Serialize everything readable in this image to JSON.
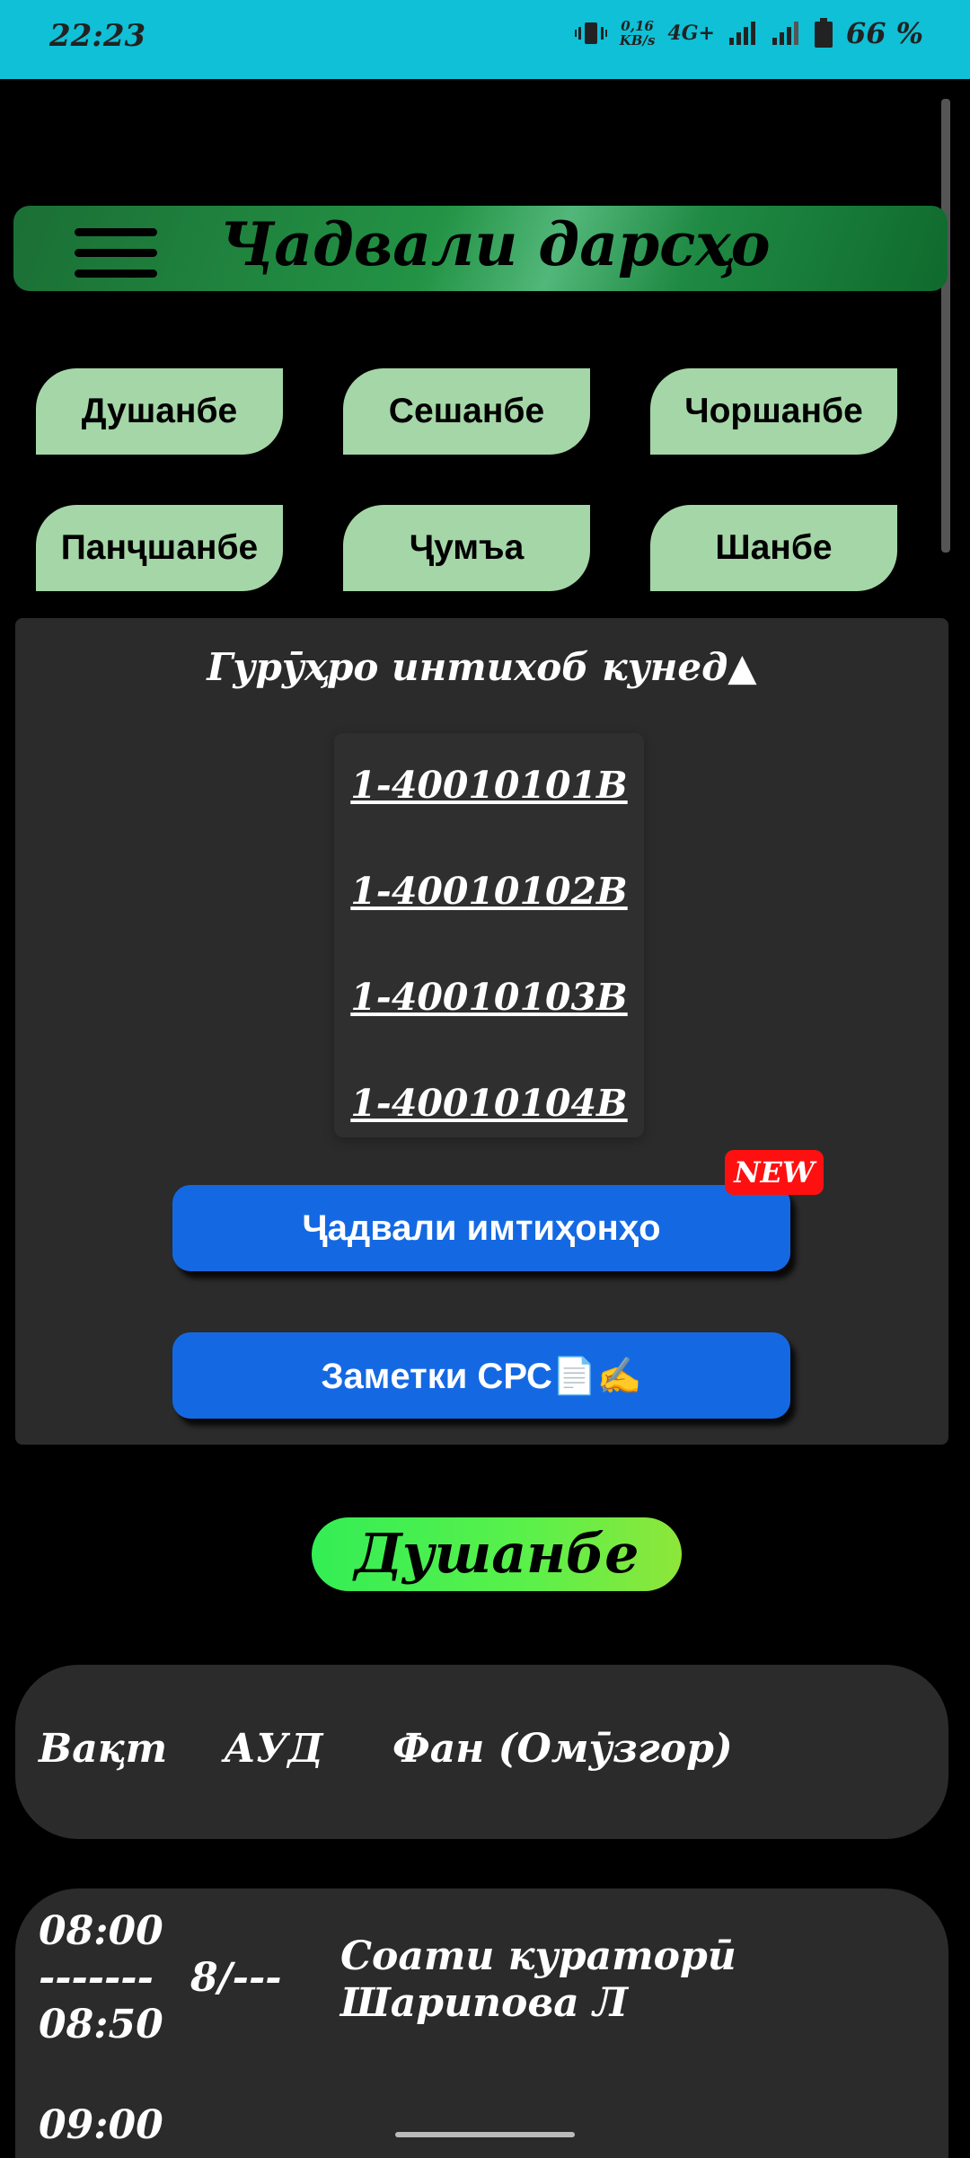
{
  "status_bar": {
    "time": "22:23",
    "net_speed_value": "0,16",
    "net_speed_unit": "KB/s",
    "network": "4G+",
    "battery": "66 %",
    "icons": [
      "vibrate-icon",
      "signal-icon",
      "signal-icon",
      "battery-icon"
    ]
  },
  "header": {
    "title": "Ҷадвали дарсҳо"
  },
  "days": {
    "mon": "Душанбе",
    "tue": "Сешанбе",
    "wed": "Чоршанбе",
    "thu": "Панҷшанбе",
    "fri": "Ҷумъа",
    "sat": "Шанбе"
  },
  "group_panel": {
    "title": "Гурӯҳро интихоб кунед▲",
    "groups": [
      "1-40010101В",
      "1-40010102В",
      "1-40010103В",
      "1-40010104В"
    ],
    "exam_button": "Ҷадвали имтиҳонҳо",
    "new_badge": "NEW",
    "notes_button": "Заметки СРС📄✍️"
  },
  "selected_day": "Душанбе",
  "table": {
    "headers": {
      "time": "Вақт",
      "room": "АУД",
      "subject": "Фан (Омӯзгор)"
    },
    "rows": [
      {
        "time_start": "08:00",
        "time_sep": "-------",
        "time_end": "08:50",
        "room": "8/---",
        "subject_line1": "Соати кураторӣ",
        "subject_line2": "Шарипова Л"
      }
    ],
    "next_time_partial": "09:00"
  },
  "colors": {
    "status_bar": "#0fc0d6",
    "day_button": "#a5d6a7",
    "action_button": "#1469e3",
    "badge": "#ff1010",
    "panel": "#2b2b2b"
  }
}
